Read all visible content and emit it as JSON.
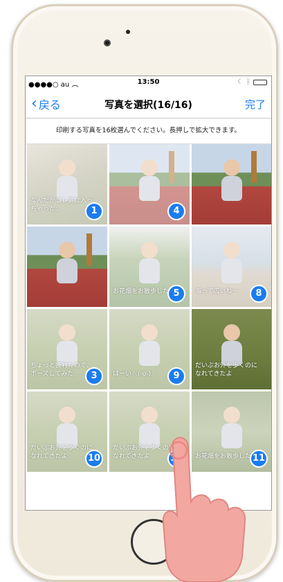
{
  "statusbar": {
    "carrier": "●●●●○ au",
    "time": "13:50"
  },
  "nav": {
    "back_label": "戻る",
    "title": "写真を選択(16/16)",
    "done_label": "完了"
  },
  "instruction": "印刷する写真を16枚選んでください。長押しで拡大できます。",
  "photos": [
    {
      "caption": "なんだかコレ気に入っちゃった。",
      "number": "1",
      "scene": "tree-closeup"
    },
    {
      "caption": "",
      "number": "4",
      "scene": "track-giraffe"
    },
    {
      "caption": "",
      "number": "",
      "scene": "track-giraffe"
    },
    {
      "caption": "",
      "number": "",
      "scene": "track-giraffe"
    },
    {
      "caption": "お花畑をお散歩したよ",
      "number": "5",
      "scene": "garden"
    },
    {
      "caption": "海って広いね〜",
      "number": "8",
      "scene": "beach"
    },
    {
      "caption": "ちょっと疲れたので、ポーズしてみた",
      "number": "3",
      "scene": "grass"
    },
    {
      "caption": "はーい＼(-o-)／",
      "number": "9",
      "scene": "grass"
    },
    {
      "caption": "だいぶお外を歩くのになれてきたよ",
      "number": "",
      "scene": "grass-dark"
    },
    {
      "caption": "だいぶお外を歩くのになれてきたよ",
      "number": "10",
      "scene": "grass"
    },
    {
      "caption": "だいぶお外を歩くのになれてきたよ",
      "number": "12",
      "scene": "grass"
    },
    {
      "caption": "お花畑をお散歩したよ",
      "number": "11",
      "scene": "garden-umbrella"
    }
  ],
  "colors": {
    "accent": "#1a7cf0",
    "battery": "#2fd24a"
  }
}
